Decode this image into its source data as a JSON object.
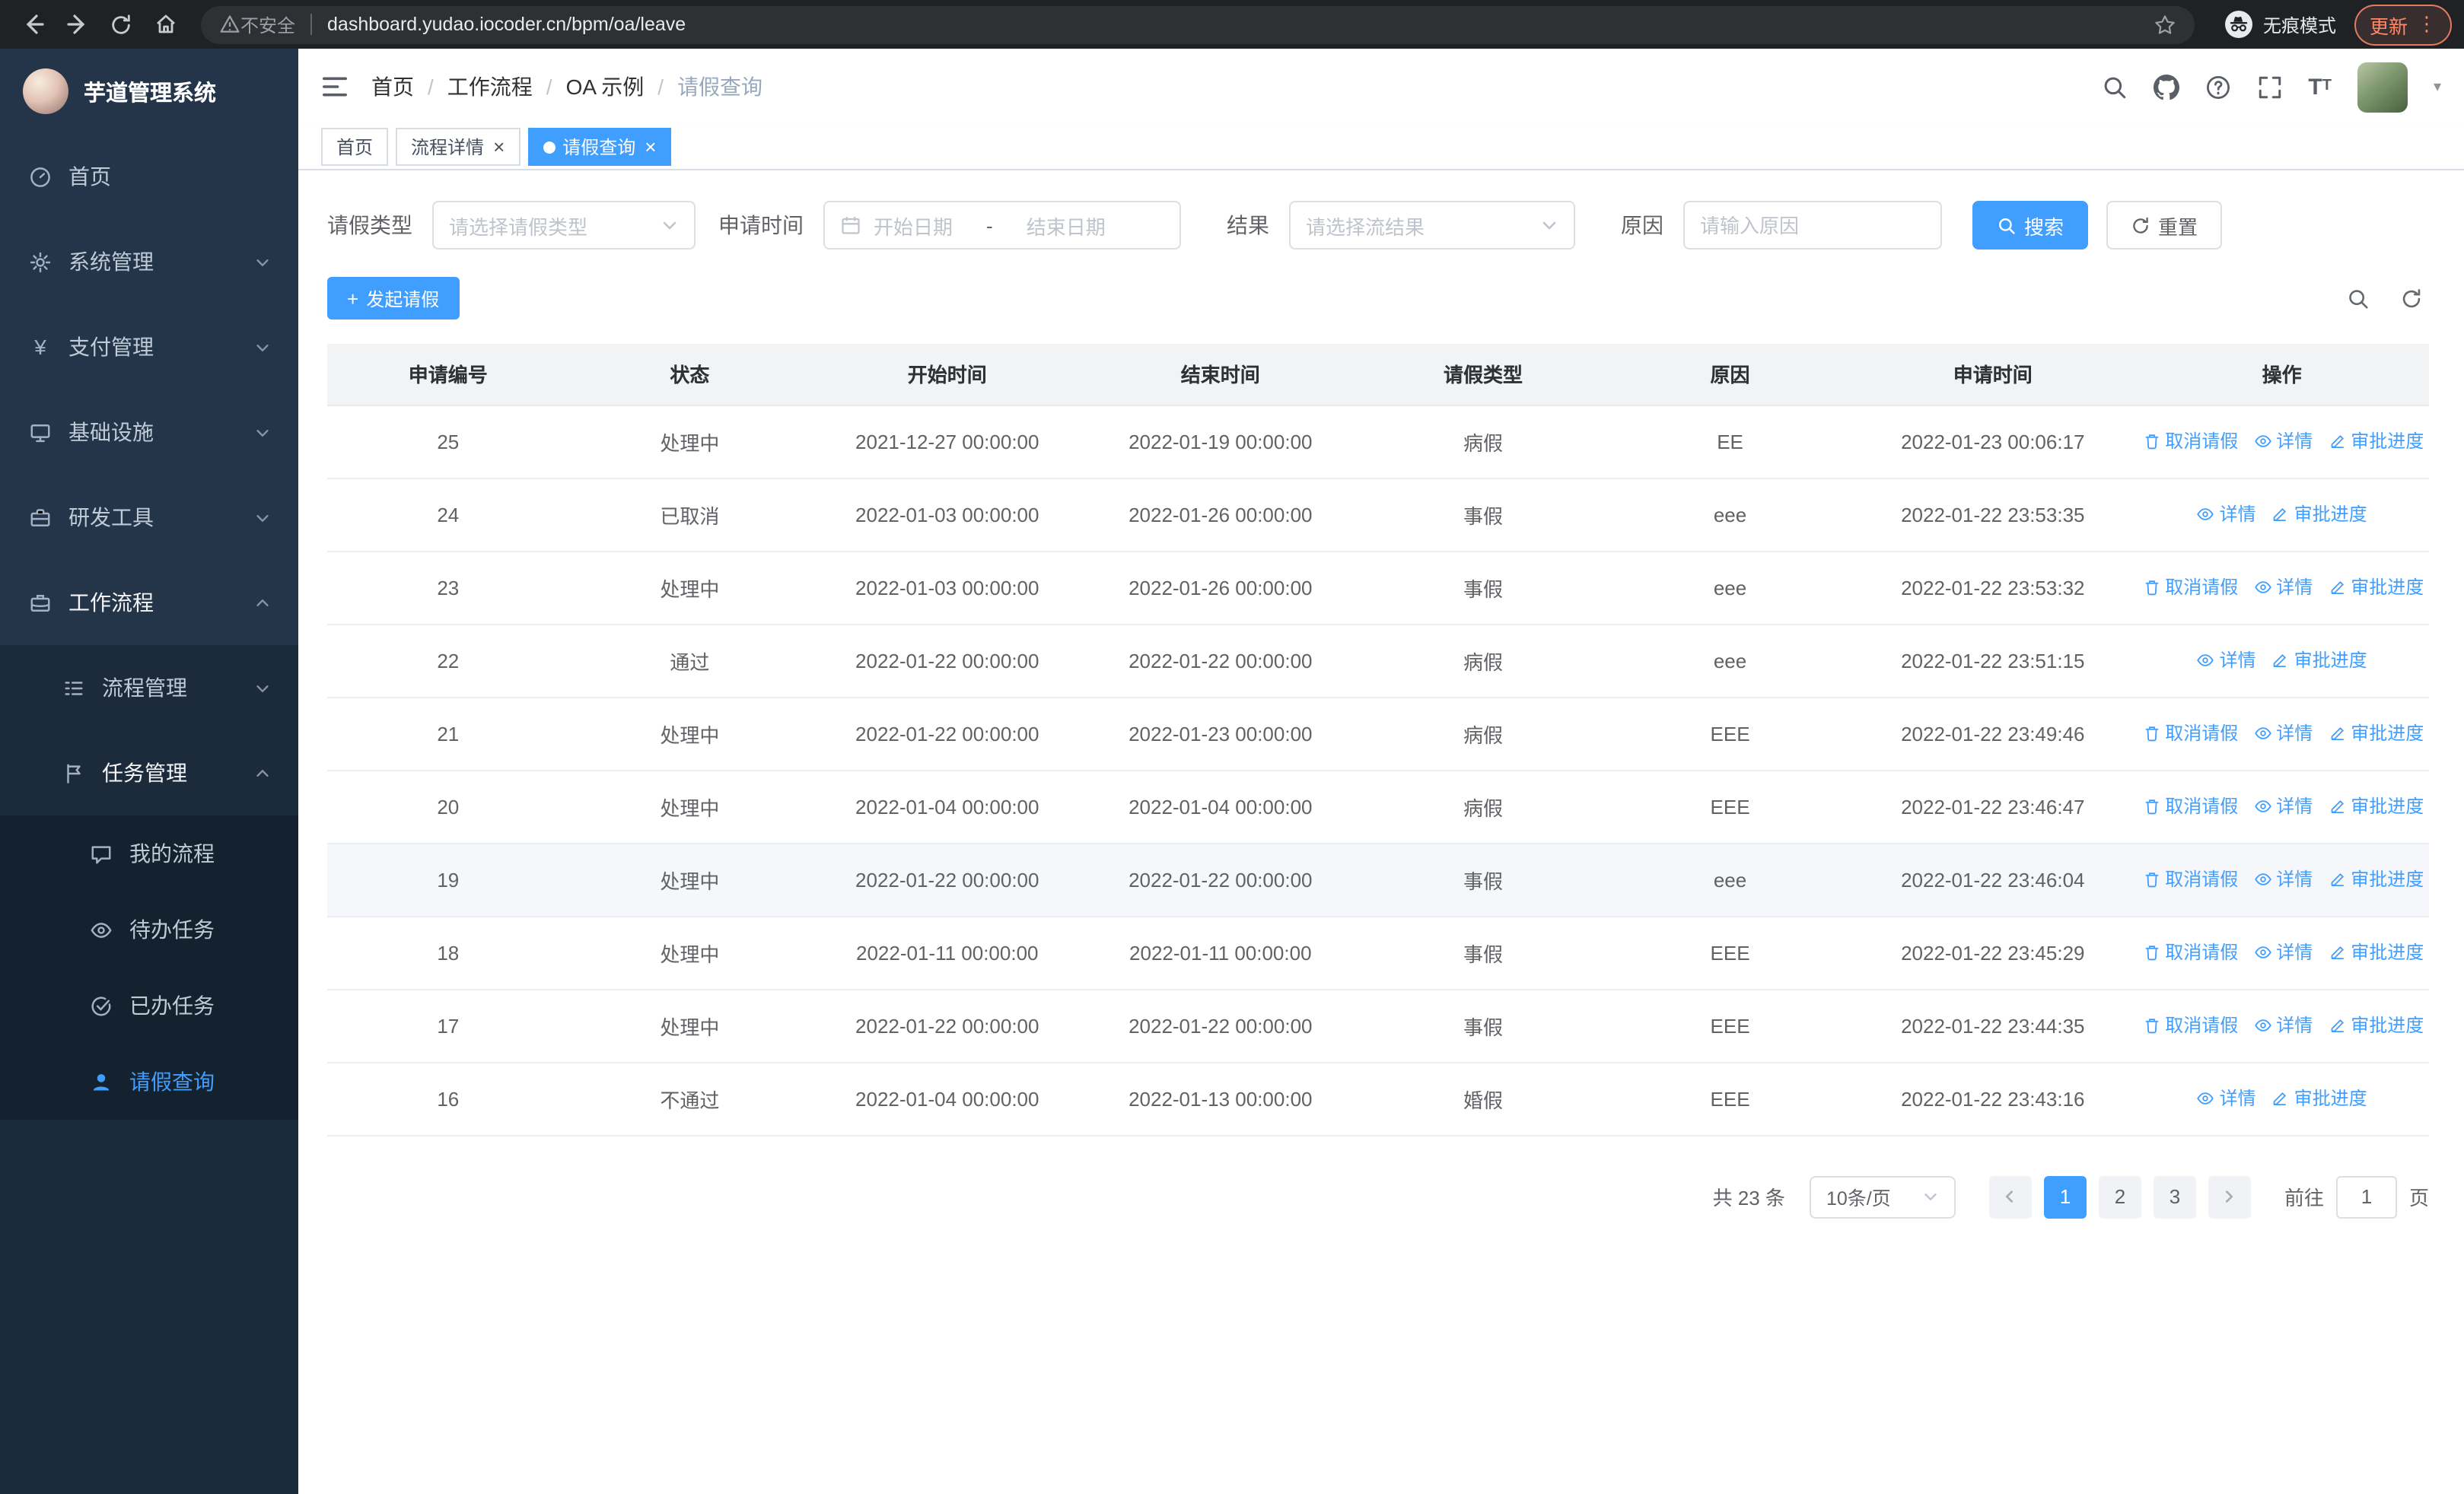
{
  "colors": {
    "accent": "#409eff",
    "sidebar_bg": "#24354a",
    "sidebar_submenu_bg": "#1c2b3c",
    "sidebar_deep_bg": "#142230",
    "browser_bar_bg": "#202124",
    "update_badge": "#ff8a65",
    "table_header_bg": "#f2f3f5"
  },
  "browser": {
    "security_label": "不安全",
    "url": "dashboard.yudao.iocoder.cn/bpm/oa/leave",
    "incognito_label": "无痕模式",
    "update_label": "更新"
  },
  "sidebar": {
    "logo_title": "芋道管理系统",
    "items": [
      {
        "label": "首页"
      },
      {
        "label": "系统管理"
      },
      {
        "label": "支付管理"
      },
      {
        "label": "基础设施"
      },
      {
        "label": "研发工具"
      },
      {
        "label": "工作流程"
      },
      {
        "label": "流程管理"
      },
      {
        "label": "任务管理"
      },
      {
        "label": "我的流程"
      },
      {
        "label": "待办任务"
      },
      {
        "label": "已办任务"
      },
      {
        "label": "请假查询"
      }
    ]
  },
  "header": {
    "breadcrumb": [
      {
        "label": "首页"
      },
      {
        "label": "工作流程"
      },
      {
        "label": "OA 示例"
      },
      {
        "label": "请假查询"
      }
    ]
  },
  "tabs": [
    {
      "label": "首页"
    },
    {
      "label": "流程详情"
    },
    {
      "label": "请假查询"
    }
  ],
  "filters": {
    "leave_type_label": "请假类型",
    "leave_type_placeholder": "请选择请假类型",
    "apply_time_label": "申请时间",
    "start_date_placeholder": "开始日期",
    "range_separator": "-",
    "end_date_placeholder": "结束日期",
    "result_label": "结果",
    "result_placeholder": "请选择流结果",
    "reason_label": "原因",
    "reason_placeholder": "请输入原因",
    "search_button": "搜索",
    "reset_button": "重置"
  },
  "toolbar": {
    "create_button": "发起请假"
  },
  "table": {
    "headers": [
      "申请编号",
      "状态",
      "开始时间",
      "结束时间",
      "请假类型",
      "原因",
      "申请时间",
      "操作"
    ],
    "action_labels": {
      "cancel": "取消请假",
      "detail": "详情",
      "progress": "审批进度"
    },
    "rows": [
      {
        "id": "25",
        "status": "处理中",
        "start_time": "2021-12-27 00:00:00",
        "end_time": "2022-01-19 00:00:00",
        "leave_type": "病假",
        "reason": "EE",
        "apply_time": "2022-01-23 00:06:17",
        "actions": [
          "cancel",
          "detail",
          "progress"
        ],
        "highlighted": false
      },
      {
        "id": "24",
        "status": "已取消",
        "start_time": "2022-01-03 00:00:00",
        "end_time": "2022-01-26 00:00:00",
        "leave_type": "事假",
        "reason": "eee",
        "apply_time": "2022-01-22 23:53:35",
        "actions": [
          "detail",
          "progress"
        ],
        "highlighted": false
      },
      {
        "id": "23",
        "status": "处理中",
        "start_time": "2022-01-03 00:00:00",
        "end_time": "2022-01-26 00:00:00",
        "leave_type": "事假",
        "reason": "eee",
        "apply_time": "2022-01-22 23:53:32",
        "actions": [
          "cancel",
          "detail",
          "progress"
        ],
        "highlighted": false
      },
      {
        "id": "22",
        "status": "通过",
        "start_time": "2022-01-22 00:00:00",
        "end_time": "2022-01-22 00:00:00",
        "leave_type": "病假",
        "reason": "eee",
        "apply_time": "2022-01-22 23:51:15",
        "actions": [
          "detail",
          "progress"
        ],
        "highlighted": false
      },
      {
        "id": "21",
        "status": "处理中",
        "start_time": "2022-01-22 00:00:00",
        "end_time": "2022-01-23 00:00:00",
        "leave_type": "病假",
        "reason": "EEE",
        "apply_time": "2022-01-22 23:49:46",
        "actions": [
          "cancel",
          "detail",
          "progress"
        ],
        "highlighted": false
      },
      {
        "id": "20",
        "status": "处理中",
        "start_time": "2022-01-04 00:00:00",
        "end_time": "2022-01-04 00:00:00",
        "leave_type": "病假",
        "reason": "EEE",
        "apply_time": "2022-01-22 23:46:47",
        "actions": [
          "cancel",
          "detail",
          "progress"
        ],
        "highlighted": false
      },
      {
        "id": "19",
        "status": "处理中",
        "start_time": "2022-01-22 00:00:00",
        "end_time": "2022-01-22 00:00:00",
        "leave_type": "事假",
        "reason": "eee",
        "apply_time": "2022-01-22 23:46:04",
        "actions": [
          "cancel",
          "detail",
          "progress"
        ],
        "highlighted": true
      },
      {
        "id": "18",
        "status": "处理中",
        "start_time": "2022-01-11 00:00:00",
        "end_time": "2022-01-11 00:00:00",
        "leave_type": "事假",
        "reason": "EEE",
        "apply_time": "2022-01-22 23:45:29",
        "actions": [
          "cancel",
          "detail",
          "progress"
        ],
        "highlighted": false
      },
      {
        "id": "17",
        "status": "处理中",
        "start_time": "2022-01-22 00:00:00",
        "end_time": "2022-01-22 00:00:00",
        "leave_type": "事假",
        "reason": "EEE",
        "apply_time": "2022-01-22 23:44:35",
        "actions": [
          "cancel",
          "detail",
          "progress"
        ],
        "highlighted": false
      },
      {
        "id": "16",
        "status": "不通过",
        "start_time": "2022-01-04 00:00:00",
        "end_time": "2022-01-13 00:00:00",
        "leave_type": "婚假",
        "reason": "EEE",
        "apply_time": "2022-01-22 23:43:16",
        "actions": [
          "detail",
          "progress"
        ],
        "highlighted": false
      }
    ]
  },
  "pagination": {
    "total_text": "共 23 条",
    "page_size": "10条/页",
    "pages": [
      "1",
      "2",
      "3"
    ],
    "active_page": "1",
    "goto_prefix": "前往",
    "goto_value": "1",
    "goto_suffix": "页"
  }
}
